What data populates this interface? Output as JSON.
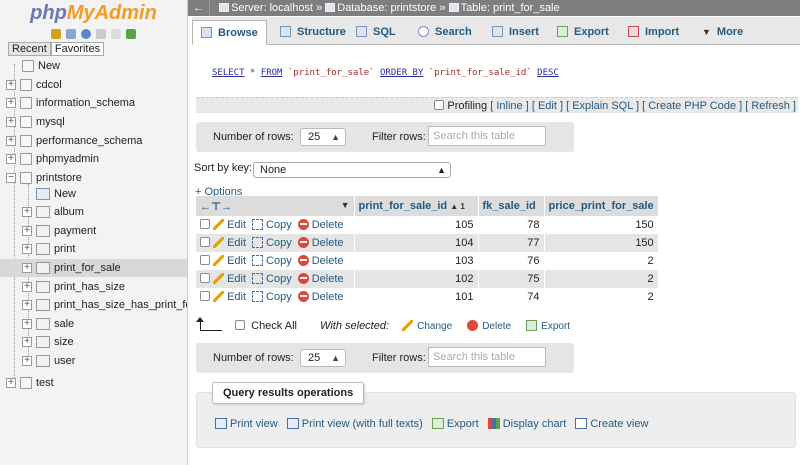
{
  "logo": {
    "part1": "php",
    "part2": "MyAdmin"
  },
  "nav_tabs": {
    "recent": "Recent",
    "favorites": "Favorites"
  },
  "tree": {
    "new_root": "New",
    "databases": [
      "cdcol",
      "information_schema",
      "mysql",
      "performance_schema",
      "phpmyadmin",
      "printstore"
    ],
    "printstore_new": "New",
    "tables": [
      "album",
      "payment",
      "print",
      "print_for_sale",
      "print_has_size",
      "print_has_size_has_print_for",
      "sale",
      "size",
      "user"
    ],
    "last_db": "test"
  },
  "breadcrumb": {
    "back": "←",
    "server": "Server: localhost",
    "sep1": "»",
    "database": "Database: printstore",
    "sep2": "»",
    "table": "Table: print_for_sale"
  },
  "tabs": {
    "browse": "Browse",
    "structure": "Structure",
    "sql": "SQL",
    "search": "Search",
    "insert": "Insert",
    "export": "Export",
    "import": "Import",
    "more": "More"
  },
  "sql": {
    "select": "SELECT",
    "star": " * ",
    "from": "FROM",
    "table": " `print_for_sale` ",
    "order_by": "ORDER BY",
    "column": " `print_for_sale_id` ",
    "desc": "DESC"
  },
  "profiling": {
    "label": "Profiling",
    "inline": "[ Inline ]",
    "edit": "[ Edit ]",
    "explain": "[ Explain SQL ]",
    "create_php": "[ Create PHP Code ]",
    "refresh": "[ Refresh ]"
  },
  "navigation": {
    "rows_label": "Number of rows:",
    "rows_value": "25",
    "filter_label": "Filter rows:",
    "filter_placeholder": "Search this table"
  },
  "sort": {
    "label": "Sort by key:",
    "value": "None"
  },
  "options_link": "+ Options",
  "table": {
    "columns": [
      "print_for_sale_id",
      "fk_sale_id",
      "price_print_for_sale"
    ],
    "sort_indicator": "▲ 1",
    "actions": {
      "edit": "Edit",
      "copy": "Copy",
      "delete": "Delete"
    },
    "rows": [
      {
        "id": "105",
        "fk": "78",
        "price": "150"
      },
      {
        "id": "104",
        "fk": "77",
        "price": "150"
      },
      {
        "id": "103",
        "fk": "76",
        "price": "2"
      },
      {
        "id": "102",
        "fk": "75",
        "price": "2"
      },
      {
        "id": "101",
        "fk": "74",
        "price": "2"
      }
    ]
  },
  "bulk": {
    "check_all": "Check All",
    "with_selected": "With selected:",
    "change": "Change",
    "delete": "Delete",
    "export": "Export"
  },
  "query_ops": {
    "legend": "Query results operations",
    "print_view": "Print view",
    "print_view_full": "Print view (with full texts)",
    "export": "Export",
    "display_chart": "Display chart",
    "create_view": "Create view"
  }
}
